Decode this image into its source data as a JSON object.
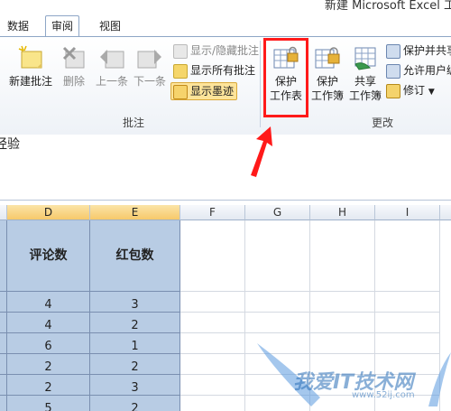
{
  "window": {
    "title": "新建 Microsoft Excel 工"
  },
  "tabs": [
    {
      "label": "数据"
    },
    {
      "label": "审阅"
    },
    {
      "label": "视图"
    }
  ],
  "ribbon": {
    "comments_group": {
      "label": "批注",
      "new_comment": "新建批注",
      "delete": "删除",
      "previous": "上一条",
      "next": "下一条",
      "show_hide_comment": "显示/隐藏批注",
      "show_all_comments": "显示所有批注",
      "show_ink": "显示墨迹"
    },
    "changes_group": {
      "label": "更改",
      "protect_sheet_line1": "保护",
      "protect_sheet_line2": "工作表",
      "protect_workbook_line1": "保护",
      "protect_workbook_line2": "工作簿",
      "share_workbook_line1": "共享",
      "share_workbook_line2": "工作簿",
      "protect_and_share": "保护并共享",
      "allow_users": "允许用户编",
      "track_changes": "修订"
    }
  },
  "formula_bar": {
    "content": "经验"
  },
  "sheet": {
    "columns": [
      "D",
      "E",
      "F",
      "G",
      "H",
      "I"
    ],
    "headers": [
      "评论数",
      "红包数"
    ],
    "rows": [
      [
        "4",
        "3"
      ],
      [
        "4",
        "2"
      ],
      [
        "6",
        "1"
      ],
      [
        "2",
        "2"
      ],
      [
        "2",
        "3"
      ],
      [
        "5",
        "2"
      ]
    ]
  },
  "watermark": {
    "text": "我爱IT技术网",
    "url": "www.52ij.com"
  },
  "colors": {
    "highlight": "#ff1a1a",
    "selected_cells": "#b8cce4"
  }
}
